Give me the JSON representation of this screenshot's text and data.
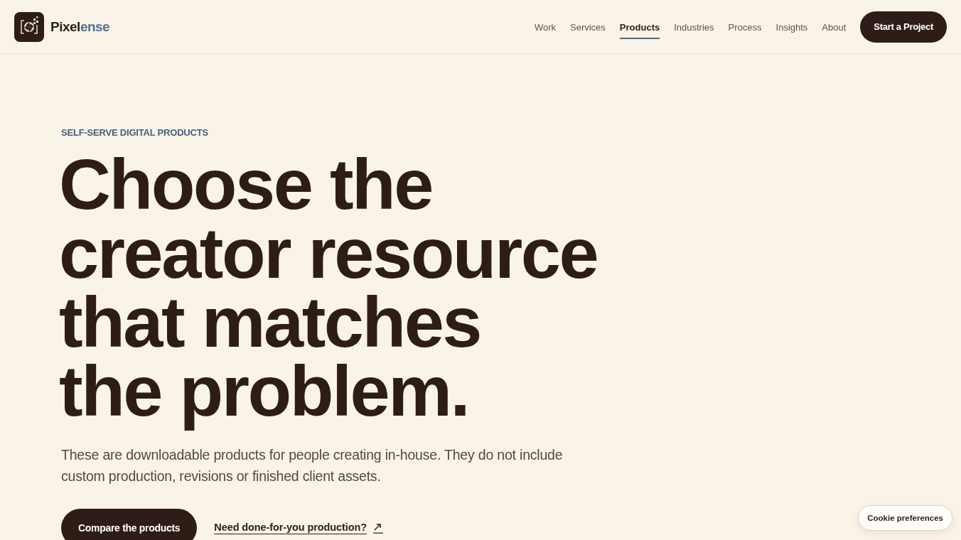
{
  "header": {
    "logo": {
      "name_main": "Pixel",
      "name_accent": "ense"
    },
    "nav": [
      {
        "label": "Work",
        "selected": false
      },
      {
        "label": "Services",
        "selected": false
      },
      {
        "label": "Products",
        "selected": true
      },
      {
        "label": "Industries",
        "selected": false
      },
      {
        "label": "Process",
        "selected": false
      },
      {
        "label": "Insights",
        "selected": false
      },
      {
        "label": "About",
        "selected": false
      }
    ],
    "cta": "Start a Project"
  },
  "hero": {
    "eyebrow": "SELF-SERVE DIGITAL PRODUCTS",
    "headline": "Choose the\ncreator resource\nthat matches\nthe problem.",
    "description": "These are downloadable products for people creating in-house. They do not include custom production, revisions or finished client assets.",
    "primary_button": "Compare the products",
    "secondary_link": "Need done-for-you production?"
  },
  "cookie_button": "Cookie preferences"
}
